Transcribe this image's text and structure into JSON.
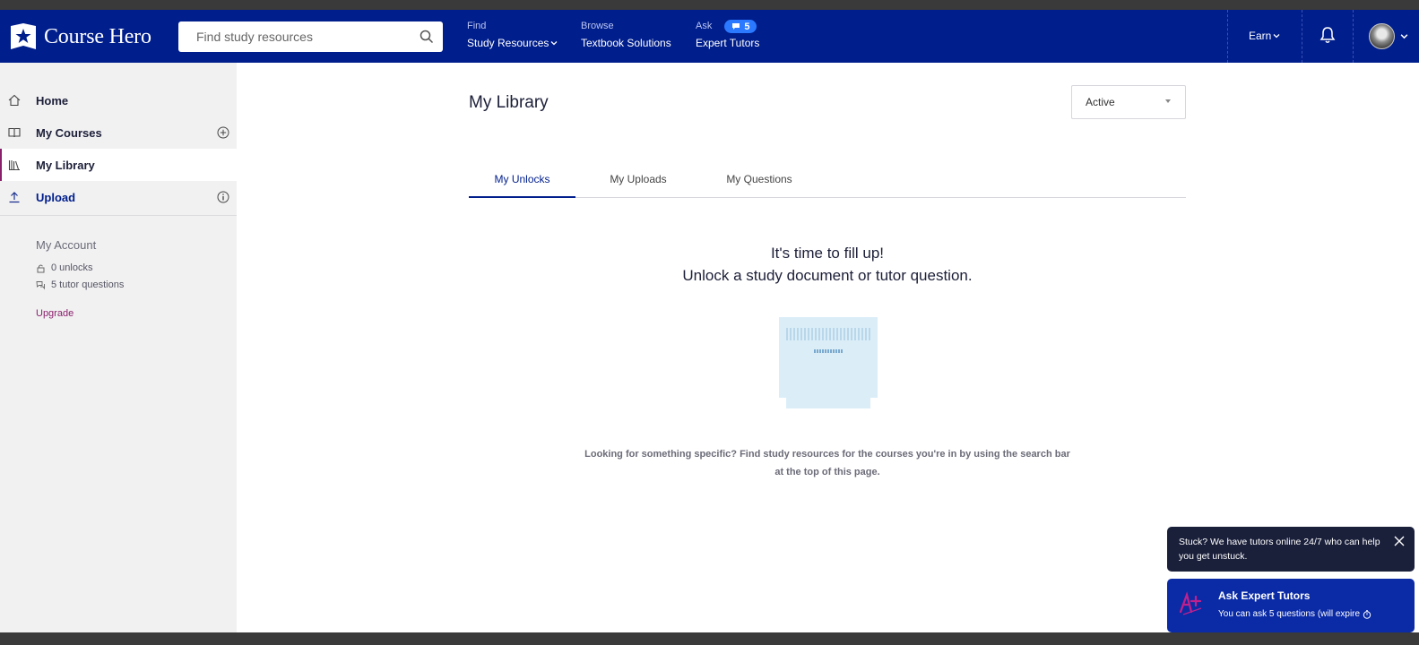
{
  "header": {
    "logo_text": "Course Hero",
    "search_placeholder": "Find study resources",
    "nav": {
      "find_label": "Find",
      "find_link": "Study Resources",
      "browse_label": "Browse",
      "browse_link": "Textbook Solutions",
      "ask_label": "Ask",
      "ask_badge_count": "5",
      "ask_link": "Expert Tutors"
    },
    "earn_label": "Earn"
  },
  "sidebar": {
    "items": [
      {
        "label": "Home",
        "icon": "home-icon"
      },
      {
        "label": "My Courses",
        "icon": "book-icon"
      },
      {
        "label": "My Library",
        "icon": "library-icon"
      },
      {
        "label": "Upload",
        "icon": "upload-icon"
      }
    ],
    "account": {
      "title": "My Account",
      "unlocks": "0 unlocks",
      "tutor_questions": "5 tutor questions",
      "upgrade": "Upgrade"
    }
  },
  "main": {
    "title": "My Library",
    "filter_value": "Active",
    "tabs": [
      {
        "label": "My Unlocks",
        "active": true
      },
      {
        "label": "My Uploads",
        "active": false
      },
      {
        "label": "My Questions",
        "active": false
      }
    ],
    "empty_line1": "It's time to fill up!",
    "empty_line2": "Unlock a study document or tutor question.",
    "help_text": "Looking for something specific? Find study resources for the courses you're in by using the search bar at the top of this page."
  },
  "toasts": {
    "stuck_text": "Stuck? We have tutors online 24/7 who can help you get unstuck.",
    "ask_title": "Ask Expert Tutors",
    "ask_sub": "You can ask 5 questions (will expire"
  },
  "colors": {
    "header_bg": "#001e8c",
    "accent_magenta": "#8a1f6b",
    "sidebar_bg": "#f1f1f2",
    "toast_dark": "#1a1f3a",
    "toast_blue": "#0a2aa6"
  }
}
